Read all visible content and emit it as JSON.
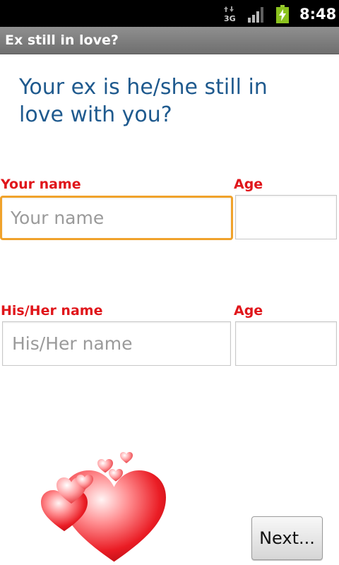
{
  "status_bar": {
    "time": "8:48",
    "network_type": "3G",
    "icons": [
      "network-3g-icon",
      "signal-strength-icon",
      "battery-charging-icon"
    ]
  },
  "app": {
    "title": "Ex still in love?"
  },
  "main": {
    "heading": "Your ex is he/she still in love with you?",
    "your_name": {
      "label": "Your name",
      "placeholder": "Your name",
      "value": ""
    },
    "your_age": {
      "label": "Age",
      "value": ""
    },
    "their_name": {
      "label": "His/Her name",
      "placeholder": "His/Her name",
      "value": ""
    },
    "their_age": {
      "label": "Age",
      "value": ""
    },
    "next_button": {
      "label": "Next..."
    },
    "decoration": {
      "icon": "hearts-icon"
    }
  },
  "colors": {
    "heading": "#1f5a8e",
    "label": "#e0161b",
    "focus_border": "#f0a22b",
    "status_bar": "#000000",
    "title_bar": "#7f7f7f",
    "heart": "#e8141c"
  }
}
